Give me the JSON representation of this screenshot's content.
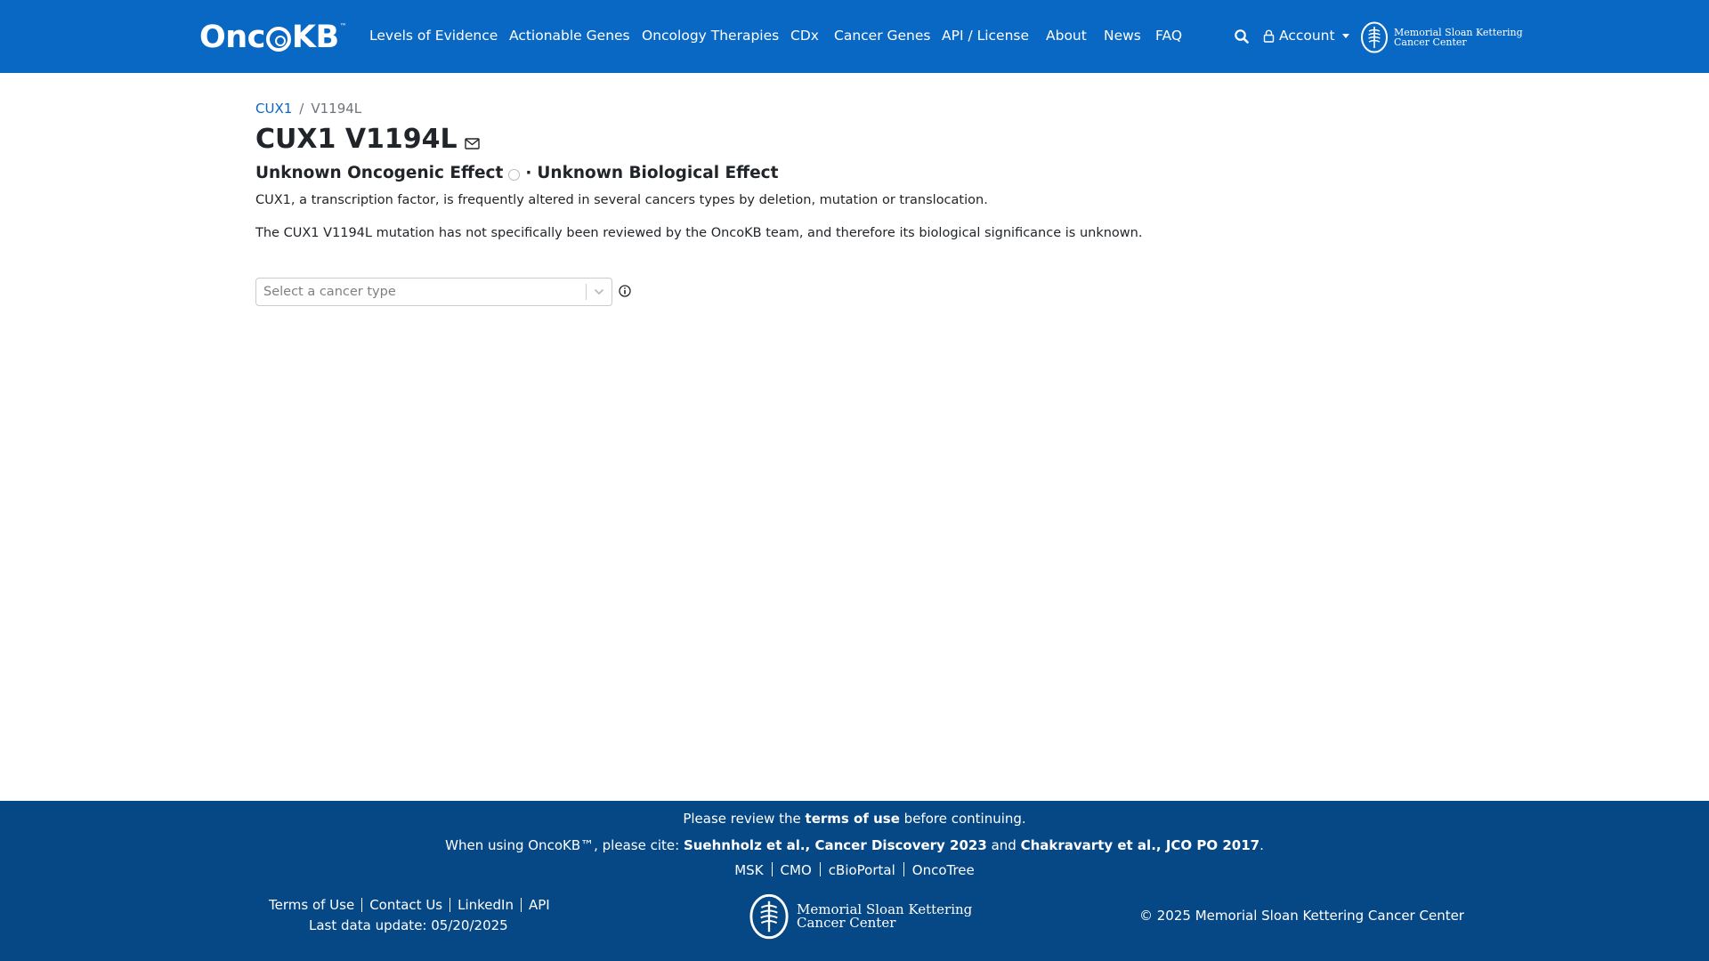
{
  "nav": {
    "brand": "OncKB",
    "brand_parts": [
      "Onc",
      "KB"
    ],
    "brand_tm": "™",
    "items": [
      {
        "label": "Levels of Evidence"
      },
      {
        "label": "Actionable Genes"
      },
      {
        "label": "Oncology Therapies"
      },
      {
        "label": "CDx"
      },
      {
        "label": "Cancer Genes"
      },
      {
        "label": "API / License"
      },
      {
        "label": "About"
      },
      {
        "label": "News"
      },
      {
        "label": "FAQ"
      }
    ],
    "account_label": "Account",
    "msk_line1": "Memorial Sloan Kettering",
    "msk_line2": "Cancer Center"
  },
  "breadcrumb": {
    "gene": "CUX1",
    "separator": "/",
    "alteration": "V1194L"
  },
  "title": "CUX1 V1194L",
  "effects": {
    "oncogenic": "Unknown Oncogenic Effect",
    "separator": "·",
    "biological": "Unknown Biological Effect"
  },
  "descriptions": [
    "CUX1, a transcription factor, is frequently altered in several cancers types by deletion, mutation or translocation.",
    "The CUX1 V1194L mutation has not specifically been reviewed by the OncoKB team, and therefore its biological significance is unknown."
  ],
  "cancer_type_select": {
    "placeholder": "Select a cancer type"
  },
  "footer": {
    "terms_pre": "Please review the",
    "terms_link": "terms of use",
    "terms_post": "before continuing.",
    "cite_pre": "When using OncoKB™, please cite:",
    "cite_1": "Suehnholz et al., Cancer Discovery 2023",
    "cite_and": "and",
    "cite_2": "Chakravarty et al., JCO PO 2017",
    "cite_end": ".",
    "partner_links": [
      "MSK",
      "CMO",
      "cBioPortal",
      "OncoTree"
    ],
    "left_links": [
      "Terms of Use",
      "Contact Us",
      "LinkedIn",
      "API"
    ],
    "last_update": "Last data update: 05/20/2025",
    "msk_line1": "Memorial Sloan Kettering",
    "msk_line2": "Cancer Center",
    "copyright": "© 2025 Memorial Sloan Kettering Cancer Center"
  },
  "colors": {
    "nav_bg": "#0968c3",
    "footer_bg": "#064785",
    "link": "#0968c3"
  }
}
